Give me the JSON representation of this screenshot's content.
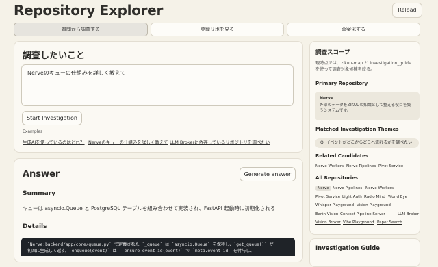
{
  "header": {
    "title": "Repository Explorer",
    "reload_label": "Reload"
  },
  "tabs": [
    {
      "label": "質問から調査する",
      "active": true
    },
    {
      "label": "登録リポを見る",
      "active": false
    },
    {
      "label": "草案化する",
      "active": false
    }
  ],
  "investigate": {
    "heading": "調査したいこと",
    "question": "Nerveのキューの仕組みを詳しく教えて",
    "start_button": "Start Investigation",
    "examples_label": "Examples",
    "examples": [
      "生成AIを使っているのはどれ？",
      "Nerveのキューの仕組みを詳しく教えて",
      "LLM Brokerに依存しているリポジトリを調べたい"
    ]
  },
  "answer": {
    "heading": "Answer",
    "generate_button": "Generate answer",
    "summary_heading": "Summary",
    "summary_text": "キューは asyncio.Queue と PostgreSQL テーブルを組み合わせて実装され、FastAPI 起動時に初期化される",
    "details_heading": "Details",
    "code_lines": [
      "`Nerve:backend/app/core/queue.py` で定義された `_queue` は `asyncio.Queue` を保持し、`get_queue()` が",
      "初回に生成して返す。`enqueue(event)` は `_ensure_event_id(event)` で `meta.event_id` を付与し、"
    ]
  },
  "scope": {
    "heading": "調査スコープ",
    "description": "現時点では、zikuu-map と investigation_guide を使って調査対象候補を絞る。",
    "primary_heading": "Primary Repository",
    "primary_name": "Nerve",
    "primary_desc": "外部のデータをZIKUUの知識として整える役目を負うシステムです。",
    "themes_heading": "Matched Investigation Themes",
    "theme": "Q. イベントがどこからどこへ流れるかを調べたい",
    "related_heading": "Related Candidates",
    "related": [
      "Nerve Workers",
      "Nerve Pipelines",
      "Pivot Service"
    ],
    "all_heading": "All Repositories",
    "all_repos": [
      "Nerve",
      "Nerve Pipelines",
      "Nerve Workers",
      "Pivot Service",
      "Light Auth",
      "Radio Mind",
      "World Eye",
      "Whisper Playground",
      "Vision Playground",
      "Earth Vision",
      "Context Pipeline Server",
      "LLM Broker",
      "Vision Broker",
      "Vibe Playground",
      "Paper Search"
    ],
    "selected_repo": "Nerve"
  },
  "guide": {
    "heading": "Investigation Guide"
  }
}
